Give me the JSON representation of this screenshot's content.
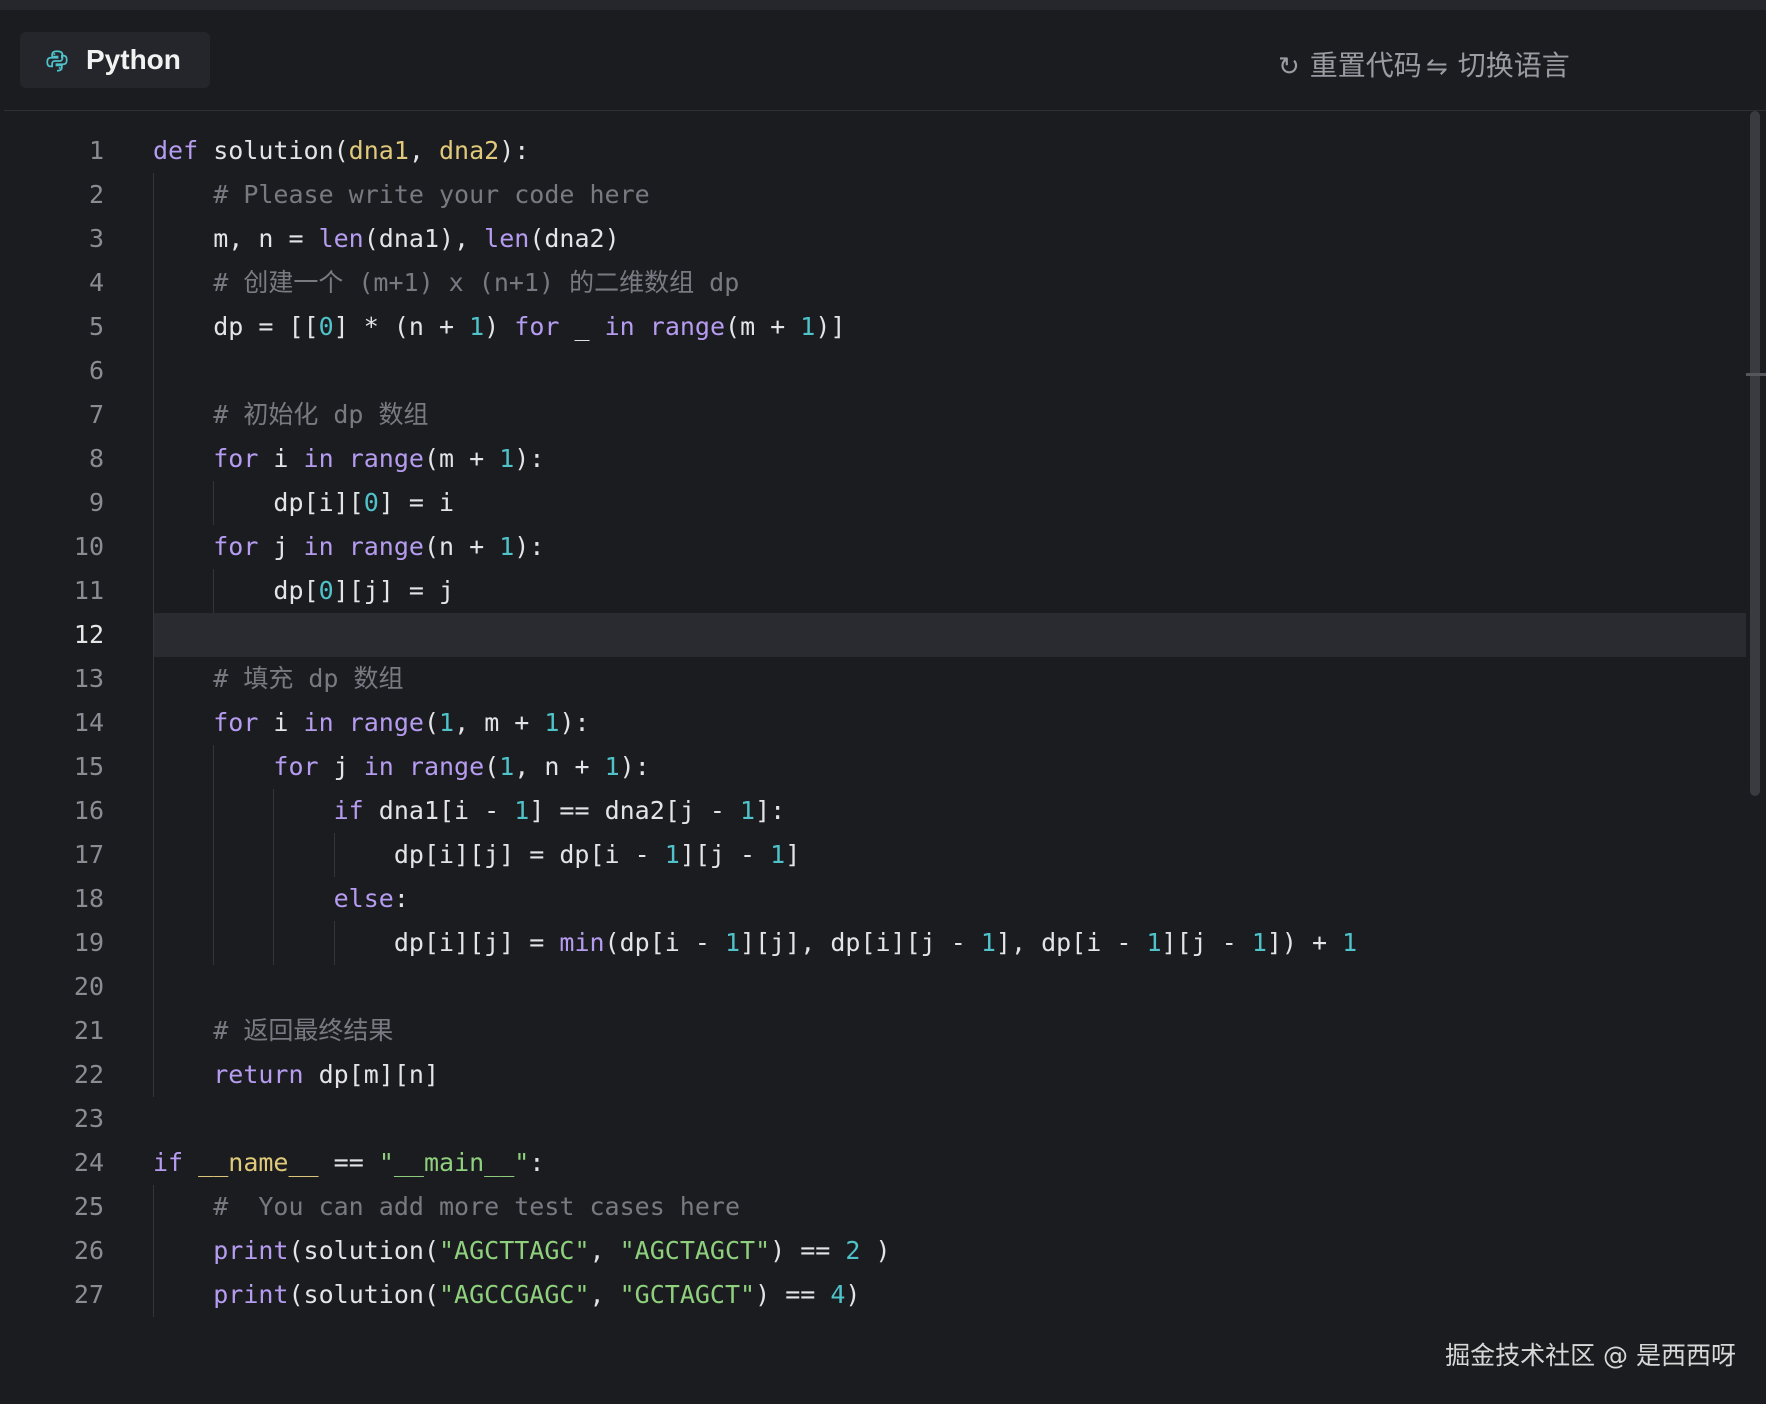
{
  "header": {
    "language_label": "Python",
    "reset_label": "重置代码",
    "switch_label": "切换语言"
  },
  "editor": {
    "active_line": 12,
    "line_numbers": [
      "1",
      "2",
      "3",
      "4",
      "5",
      "6",
      "7",
      "8",
      "9",
      "10",
      "11",
      "12",
      "13",
      "14",
      "15",
      "16",
      "17",
      "18",
      "19",
      "20",
      "21",
      "22",
      "23",
      "24",
      "25",
      "26",
      "27"
    ],
    "lines": [
      "def solution(dna1, dna2):",
      "    # Please write your code here",
      "    m, n = len(dna1), len(dna2)",
      "    # 创建一个 (m+1) x (n+1) 的二维数组 dp",
      "    dp = [[0] * (n + 1) for _ in range(m + 1)]",
      "",
      "    # 初始化 dp 数组",
      "    for i in range(m + 1):",
      "        dp[i][0] = i",
      "    for j in range(n + 1):",
      "        dp[0][j] = j",
      "",
      "    # 填充 dp 数组",
      "    for i in range(1, m + 1):",
      "        for j in range(1, n + 1):",
      "            if dna1[i - 1] == dna2[j - 1]:",
      "                dp[i][j] = dp[i - 1][j - 1]",
      "            else:",
      "                dp[i][j] = min(dp[i - 1][j], dp[i][j - 1], dp[i - 1][j - 1]) + 1",
      "",
      "    # 返回最终结果",
      "    return dp[m][n]",
      "",
      "if __name__ == \"__main__\":",
      "    #  You can add more test cases here",
      "    print(solution(\"AGCTTAGC\", \"AGCTAGCT\") == 2 )",
      "    print(solution(\"AGCCGAGC\", \"GCTAGCT\") == 4)"
    ]
  },
  "watermark": "掘金技术社区 @ 是西西呀",
  "icons": {
    "language": "python-icon",
    "reset": "refresh-icon",
    "switch": "swap-icon"
  },
  "colors": {
    "background": "#1b1c20",
    "keyword": "#b69cf0",
    "number": "#4fc3c9",
    "string": "#8fd07d",
    "comment": "#787a82"
  }
}
